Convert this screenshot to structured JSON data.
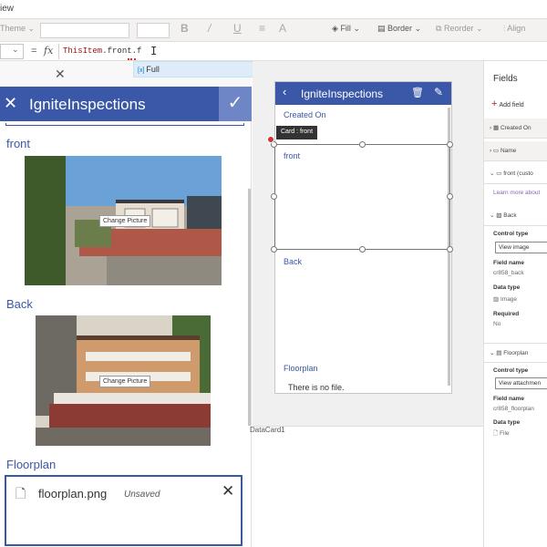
{
  "menu": {
    "view_label": "iew"
  },
  "ribbon": {
    "theme_label": "Theme",
    "fill_label": "Fill",
    "border_label": "Border",
    "reorder_label": "Reorder",
    "align_label": "Align",
    "bold_glyph": "B",
    "italic_glyph": "/",
    "underline_glyph": "U",
    "strike_glyph": "≡",
    "fontcolor_glyph": "A"
  },
  "formula": {
    "equals": "=",
    "fx": "fx",
    "expression_keyword": "ThisItem",
    "expression_rest": ".front.f"
  },
  "autocomplete": {
    "type_tag": "[x]",
    "suggestion": "Full"
  },
  "preview_form": {
    "title": "IgniteInspections",
    "fields": {
      "front_label": "front",
      "back_label": "Back",
      "floorplan_label": "Floorplan"
    },
    "change_picture_label": "Change Picture",
    "attachment": {
      "file_name": "floorplan.png",
      "status": "Unsaved"
    }
  },
  "design_form": {
    "title": "IgniteInspections",
    "created_on_label": "Created On",
    "front_label": "front",
    "back_label": "Back",
    "floorplan_label": "Floorplan",
    "no_file_text": "There is no file.",
    "card_tooltip": "Card : front"
  },
  "canvas": {
    "status_label": "DataCard1"
  },
  "fields_panel": {
    "title": "Fields",
    "add_field_label": "Add field",
    "created_on_row": "Created On",
    "name_row": "Name",
    "front_row": "front (custo",
    "learn_more": "Learn more about",
    "back_row": "Back",
    "control_type_label": "Control type",
    "back_control_type": "View image",
    "field_name_label": "Field name",
    "back_field_name": "cr858_back",
    "data_type_label": "Data type",
    "back_data_type": "Image",
    "required_label": "Required",
    "back_required": "No",
    "floorplan_row": "Floorplan",
    "floorplan_control_type": "View attachmen",
    "floorplan_field_name": "cr858_floorplan",
    "floorplan_data_type": "File"
  },
  "colors": {
    "form_header": "#3b58a8",
    "canvas_bg": "#f0f0f0",
    "accent_red": "#d13438"
  }
}
